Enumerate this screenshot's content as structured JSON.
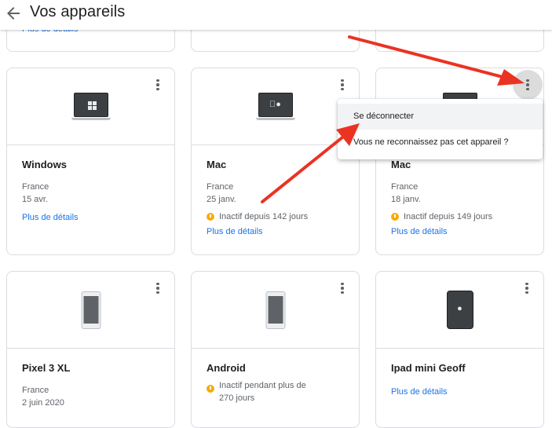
{
  "header": {
    "title": "Vos appareils",
    "partial_left_link": "Plus de détails"
  },
  "row1": [
    {
      "name": "Windows",
      "country": "France",
      "date": "15 avr.",
      "inactive": "",
      "details": "Plus de détails",
      "icon": "windows-laptop-icon"
    },
    {
      "name": "Mac",
      "country": "France",
      "date": "25 janv.",
      "inactive": "Inactif depuis 142 jours",
      "details": "Plus de détails",
      "icon": "mac-laptop-icon"
    },
    {
      "name": "Mac",
      "country": "France",
      "date": "18 janv.",
      "inactive": "Inactif depuis 149 jours",
      "details": "Plus de détails",
      "icon": "mac-laptop-icon"
    }
  ],
  "row2": [
    {
      "name": "Pixel 3 XL",
      "country": "France",
      "date": "2 juin 2020",
      "icon": "phone-icon"
    },
    {
      "name": "Android",
      "inactive": "Inactif pendant plus de 270 jours",
      "icon": "phone-icon"
    },
    {
      "name": "Ipad mini Geoff",
      "details": "Plus de détails",
      "icon": "tablet-icon"
    }
  ],
  "menu": {
    "items": [
      "Se déconnecter",
      "Vous ne reconnaissez pas cet appareil ?"
    ]
  },
  "colors": {
    "link": "#1a73e8",
    "warning": "#f9ab00",
    "arrow": "#ea3323"
  }
}
